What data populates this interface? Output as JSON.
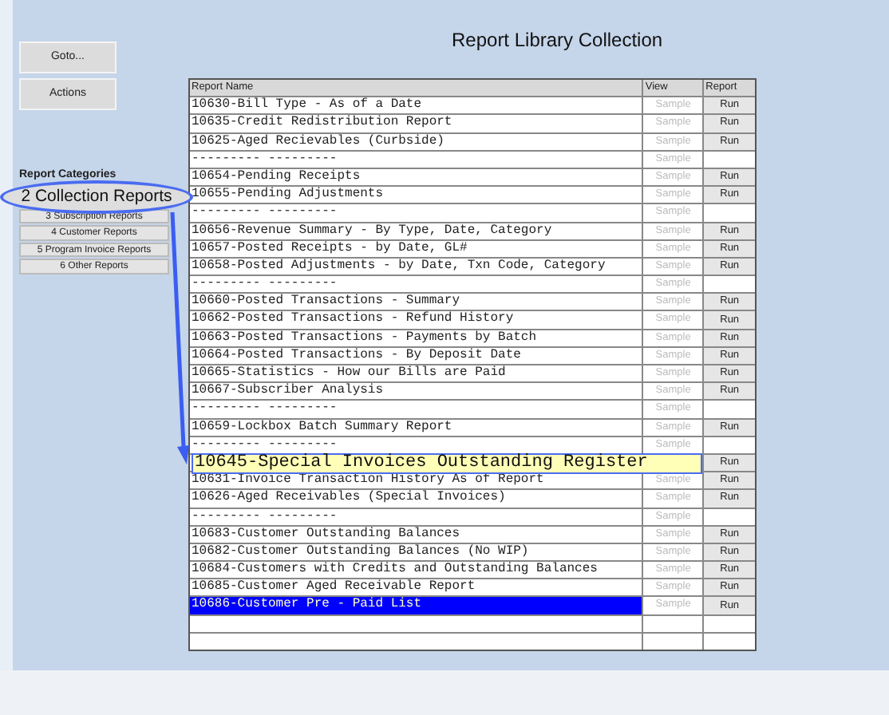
{
  "title": "Report Library Collection",
  "side_buttons": [
    "Goto...",
    "Actions"
  ],
  "categories_label": "Report Categories",
  "categories": [
    "3 Subscription Reports",
    "4 Customer Reports",
    "5 Program Invoice Reports",
    "6 Other Reports"
  ],
  "category_callout": "2 Collection Reports",
  "table": {
    "columns": [
      "Report Name",
      "View",
      "Report"
    ],
    "rows": [
      {
        "name": "10630-Bill Type - As of a Date",
        "view": "Sample",
        "report": "Run",
        "selected": false
      },
      {
        "name": "10635-Credit Redistribution Report",
        "view": "Sample",
        "report": "Run",
        "selected": false
      },
      {
        "name": "10625-Aged Recievables (Curbside)",
        "view": "Sample",
        "report": "Run",
        "selected": false
      },
      {
        "name": "---------   ---------",
        "view": "Sample",
        "selected": false
      },
      {
        "name": "10654-Pending Receipts",
        "view": "Sample",
        "report": "Run",
        "selected": false
      },
      {
        "name": "10655-Pending Adjustments",
        "view": "Sample",
        "report": "Run",
        "selected": false
      },
      {
        "name": "---------   ---------",
        "view": "Sample",
        "selected": false
      },
      {
        "name": "10656-Revenue Summary - By Type, Date, Category",
        "view": "Sample",
        "report": "Run",
        "selected": false
      },
      {
        "name": "10657-Posted Receipts - by Date, GL#",
        "view": "Sample",
        "report": "Run",
        "selected": false
      },
      {
        "name": "10658-Posted Adjustments - by Date, Txn Code, Category",
        "view": "Sample",
        "report": "Run",
        "selected": false
      },
      {
        "name": "---------   ---------",
        "view": "Sample",
        "selected": false
      },
      {
        "name": "10660-Posted Transactions - Summary",
        "view": "Sample",
        "report": "Run",
        "selected": false
      },
      {
        "name": "10662-Posted Transactions - Refund History",
        "view": "Sample",
        "report": "Run",
        "selected": false
      },
      {
        "name": "10663-Posted Transactions - Payments by Batch",
        "view": "Sample",
        "report": "Run",
        "selected": false
      },
      {
        "name": "10664-Posted Transactions - By Deposit Date",
        "view": "Sample",
        "report": "Run",
        "selected": false
      },
      {
        "name": "10665-Statistics - How our Bills are Paid",
        "view": "Sample",
        "report": "Run",
        "selected": false
      },
      {
        "name": "10667-Subscriber Analysis",
        "view": "Sample",
        "report": "Run",
        "selected": false
      },
      {
        "name": "---------   ---------",
        "view": "Sample",
        "selected": false
      },
      {
        "name": "10659-Lockbox Batch Summary Report",
        "view": "Sample",
        "report": "Run",
        "selected": false
      },
      {
        "name": "---------   ---------",
        "view": "Sample",
        "selected": false
      },
      {
        "name": "10645-Special Invoices Outstanding Register",
        "report": "Run",
        "selected": false,
        "callout": true
      },
      {
        "name": "10631-Invoice Transaction History As of Report",
        "view": "Sample",
        "report": "Run",
        "selected": false
      },
      {
        "name": "10626-Aged Receivables (Special Invoices)",
        "view": "Sample",
        "report": "Run",
        "selected": false
      },
      {
        "name": "---------   ---------",
        "view": "Sample",
        "selected": false
      },
      {
        "name": "10683-Customer Outstanding Balances",
        "view": "Sample",
        "report": "Run",
        "selected": false
      },
      {
        "name": "10682-Customer Outstanding Balances (No WIP)",
        "view": "Sample",
        "report": "Run",
        "selected": false
      },
      {
        "name": "10684-Customers with Credits and Outstanding Balances",
        "view": "Sample",
        "report": "Run",
        "selected": false
      },
      {
        "name": "10685-Customer Aged Receivable Report",
        "view": "Sample",
        "report": "Run",
        "selected": false
      },
      {
        "name": "10686-Customer Pre - Paid List",
        "view": "Sample",
        "report": "Run",
        "selected": true
      },
      {
        "selected": false
      },
      {
        "selected": false
      }
    ]
  }
}
